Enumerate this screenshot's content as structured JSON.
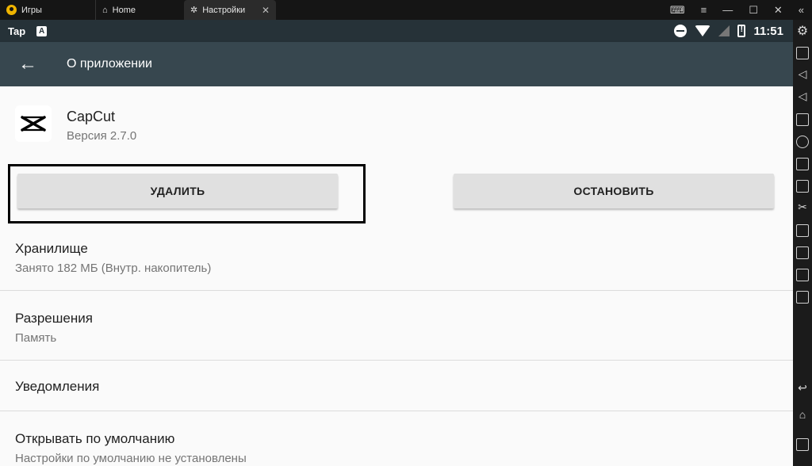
{
  "tabs": [
    {
      "label": "Игры",
      "icon": "game-logo-icon"
    },
    {
      "label": "Home",
      "icon": "home-icon"
    },
    {
      "label": "Настройки",
      "icon": "settings-gear-icon"
    }
  ],
  "status_bar": {
    "left_label": "Tap",
    "time": "11:51"
  },
  "app_bar": {
    "title": "О приложении"
  },
  "app": {
    "name": "CapCut",
    "version": "Версия 2.7.0"
  },
  "buttons": {
    "uninstall": "УДАЛИТЬ",
    "stop": "ОСТАНОВИТЬ"
  },
  "rows": {
    "storage": {
      "title": "Хранилище",
      "subtitle": "Занято 182 МБ (Внутр. накопитель)"
    },
    "permissions": {
      "title": "Разрешения",
      "subtitle": "Память"
    },
    "notifications": {
      "title": "Уведомления"
    },
    "defaults": {
      "title": "Открывать по умолчанию",
      "subtitle": "Настройки по умолчанию не установлены"
    }
  },
  "colors": {
    "status_bar": "#263238",
    "app_bar": "#37474f",
    "background": "#fafafa",
    "button": "#e0e0e0"
  }
}
